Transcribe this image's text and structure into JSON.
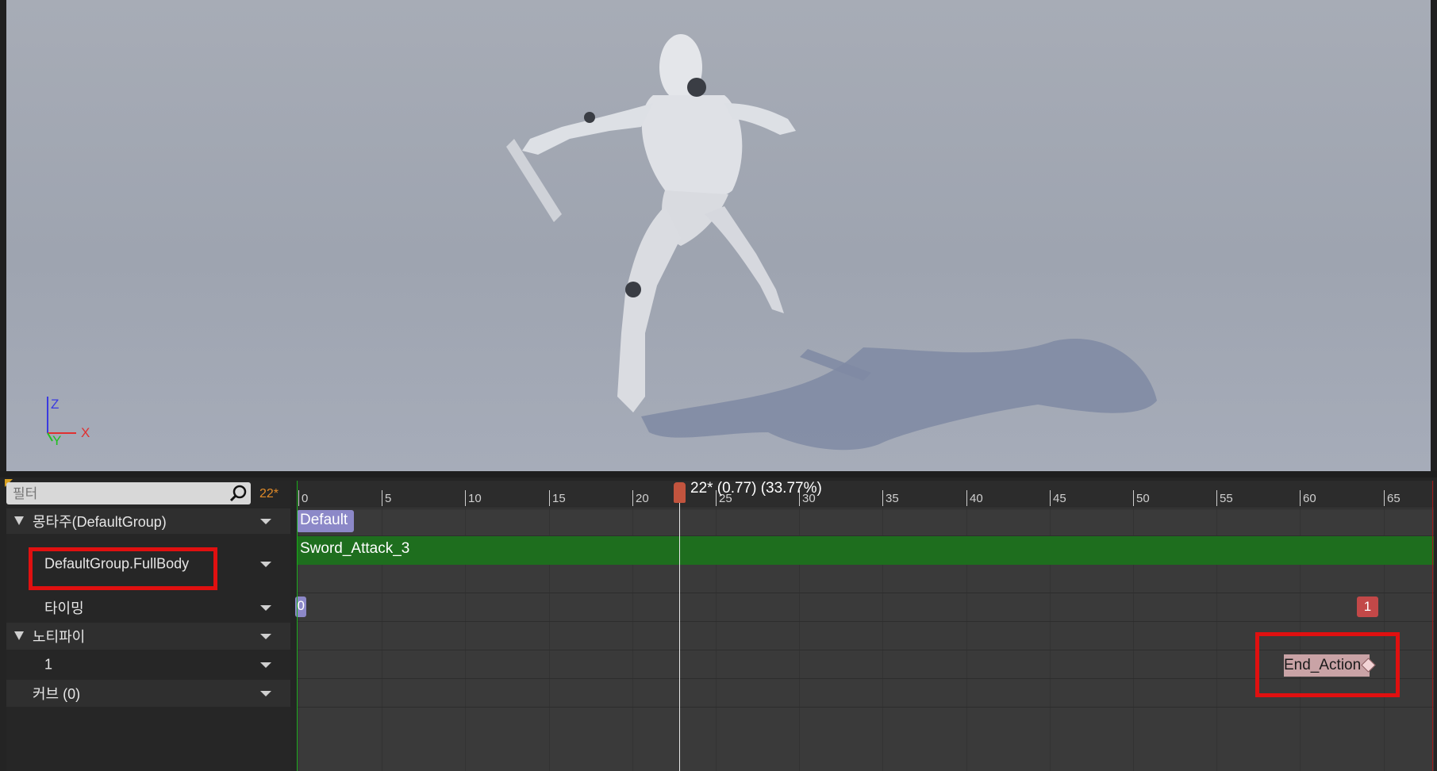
{
  "viewport": {
    "axis": {
      "z": "Z",
      "y": "Y",
      "x": "X"
    }
  },
  "filter": {
    "placeholder": "필터"
  },
  "timeline": {
    "frame_count": "22*",
    "playhead_label": "22* (0.77) (33.77%)",
    "ticks": [
      "0",
      "5",
      "10",
      "15",
      "20",
      "25",
      "30",
      "35",
      "40",
      "45",
      "50",
      "55",
      "60",
      "65"
    ]
  },
  "rows": {
    "montage": "몽타주(DefaultGroup)",
    "slot": "DefaultGroup.FullBody",
    "timing": "타이밍",
    "notifies": "노티파이",
    "notify_track": "1",
    "curves": "커브  (0)"
  },
  "tracks": {
    "section_default": "Default",
    "segment_name": "Sword_Attack_3",
    "timing_start": "0",
    "timing_end": "1",
    "notify_name": "End_Action"
  },
  "colors": {
    "highlight": "#e01010",
    "segment": "#1e6e1e",
    "section": "#8c88c8",
    "timing_marker": "#c24848",
    "frame_count": "#e08a28"
  }
}
